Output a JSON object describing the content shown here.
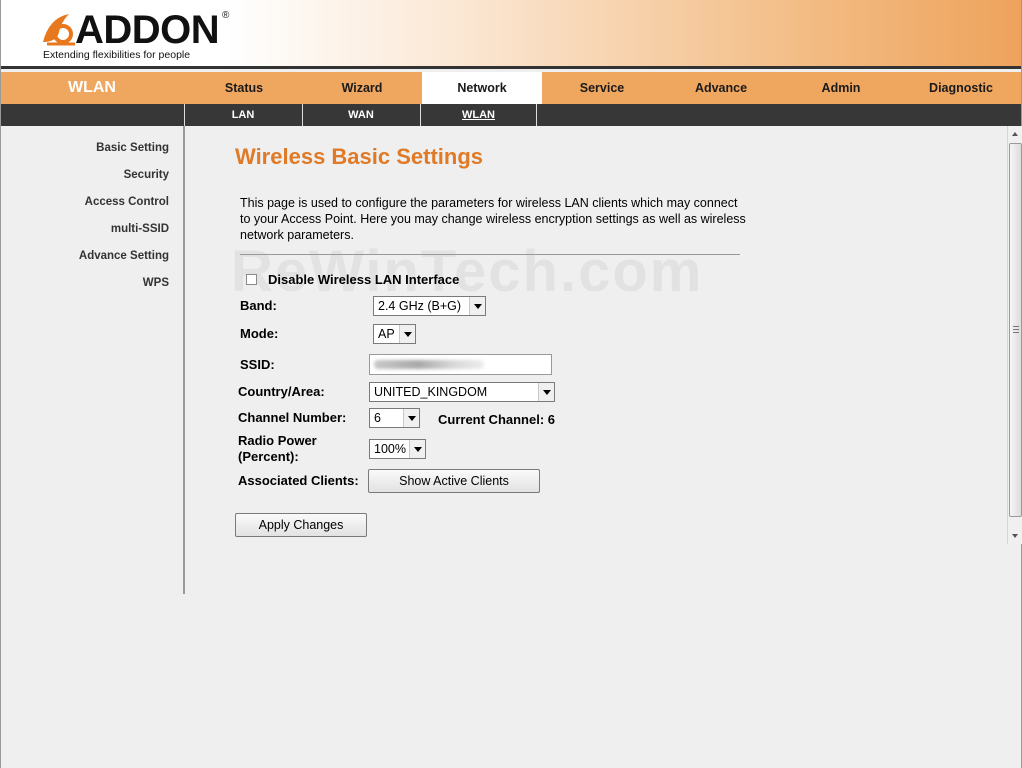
{
  "brand": {
    "name": "ADDON",
    "registered": "®",
    "tagline": "Extending flexibilities for people"
  },
  "section_title": "WLAN",
  "main_tabs": [
    {
      "label": "Status"
    },
    {
      "label": "Wizard"
    },
    {
      "label": "Network",
      "active": true
    },
    {
      "label": "Service"
    },
    {
      "label": "Advance"
    },
    {
      "label": "Admin"
    },
    {
      "label": "Diagnostic"
    }
  ],
  "sub_tabs": [
    {
      "label": "LAN"
    },
    {
      "label": "WAN"
    },
    {
      "label": "WLAN",
      "active": true
    }
  ],
  "sidebar": {
    "items": [
      {
        "label": "Basic Setting"
      },
      {
        "label": "Security"
      },
      {
        "label": "Access Control"
      },
      {
        "label": "multi-SSID"
      },
      {
        "label": "Advance Setting"
      },
      {
        "label": "WPS"
      }
    ]
  },
  "watermark": "ReWinTech.com",
  "page": {
    "title": "Wireless Basic Settings",
    "intro": "This page is used to configure the parameters for wireless LAN clients which may connect to your Access Point. Here you may change wireless encryption settings as well as wireless network parameters."
  },
  "form": {
    "disable_wlan": {
      "label": "Disable Wireless LAN Interface",
      "checked": false
    },
    "band": {
      "label": "Band:",
      "value": "2.4 GHz (B+G)"
    },
    "mode": {
      "label": "Mode:",
      "value": "AP"
    },
    "ssid": {
      "label": "SSID:"
    },
    "country": {
      "label": "Country/Area:",
      "value": "UNITED_KINGDOM"
    },
    "channel": {
      "label": "Channel Number:",
      "value": "6"
    },
    "current_channel": {
      "label": "Current Channel: 6"
    },
    "radio_power": {
      "label_line1": "Radio Power",
      "label_line2": "(Percent):",
      "value": "100%"
    },
    "associated_clients": {
      "label": "Associated Clients:",
      "button": "Show Active Clients"
    },
    "apply_button": "Apply Changes"
  }
}
